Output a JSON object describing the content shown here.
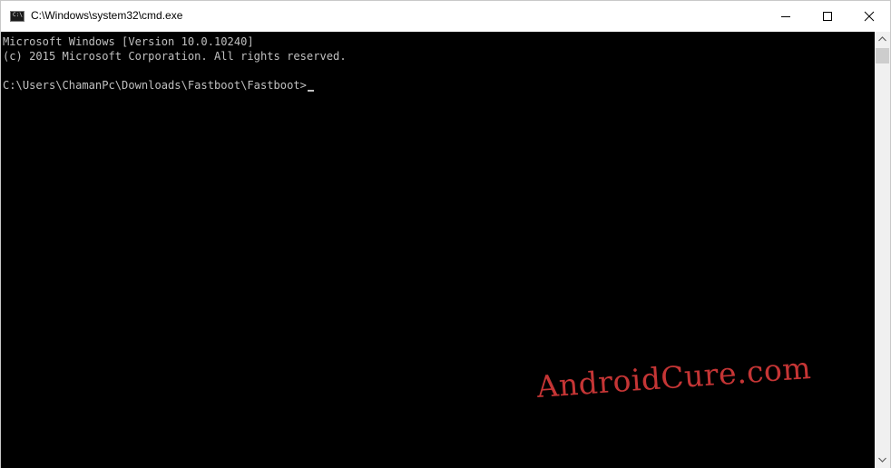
{
  "window": {
    "title": "C:\\Windows\\system32\\cmd.exe",
    "icon_label": "C:\\"
  },
  "console": {
    "lines": [
      "Microsoft Windows [Version 10.0.10240]",
      "(c) 2015 Microsoft Corporation. All rights reserved.",
      "C:\\Users\\ChamanPc\\Downloads\\Fastboot\\Fastboot>"
    ],
    "text_color": "#c0c0c0",
    "background": "#000000"
  },
  "watermark": {
    "text": "AndroidCure.com",
    "color": "#c53535"
  },
  "icons": {
    "minimize": "minimize-icon",
    "maximize": "maximize-icon",
    "close": "close-icon",
    "scroll_up": "chevron-up-icon",
    "scroll_down": "chevron-down-icon"
  }
}
